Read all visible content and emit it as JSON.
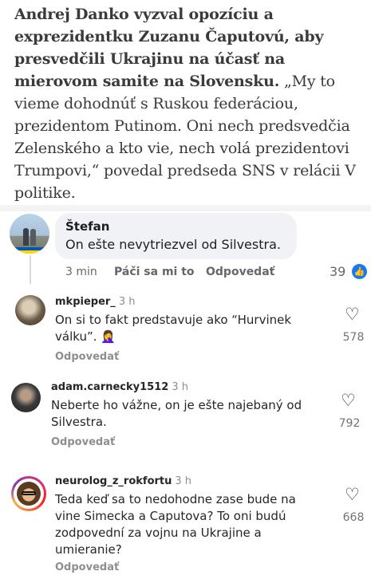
{
  "post": {
    "headline": "Andrej Danko vyzval opozíciu a exprezidentku Zuzanu Čaputovú, aby presvedčili Ukrajinu na účasť na mierovom samite na Slovensku.",
    "body": " „My to vieme dohodnúť s Ruskou federáciou, prezidentom Putinom. Oni nech predsvedčia Zelenského a kto vie, nech volá prezidentovi Trumpovi,“ povedal predseda SNS v relácii V politike."
  },
  "fb_comment": {
    "name": "Štefan",
    "text": "On ešte nevytriezvel od Silvestra.",
    "time": "3 min",
    "like_label": "Páči sa mi to",
    "reply_label": "Odpovedať",
    "reaction_count": "39",
    "reaction_icon": "thumbs-up-icon"
  },
  "ig_comments": [
    {
      "username": "mkpieper_",
      "time": "3 h",
      "text": "On si to fakt predstavuje ako “Hurvinek válku”. 🤦‍♀️",
      "reply_label": "Odpovedať",
      "likes": "578"
    },
    {
      "username": "adam.carnecky1512",
      "time": "3 h",
      "text": "Neberte ho vážne, on je ešte najebaný od Silvestra.",
      "reply_label": "Odpovedať",
      "likes": "792"
    },
    {
      "username": "neurolog_z_rokfortu",
      "time": "3 h",
      "text": "Teda keď sa to nedohodne zase bude na vine Simecka a Caputova? To oni budú zodpovední za vojnu na Ukrajine a umieranie?",
      "reply_label": "Odpovedať",
      "likes": "668"
    }
  ],
  "colors": {
    "facebook_blue": "#1877f2",
    "bubble_bg": "#f0f2f5",
    "muted_text": "#65676b"
  }
}
